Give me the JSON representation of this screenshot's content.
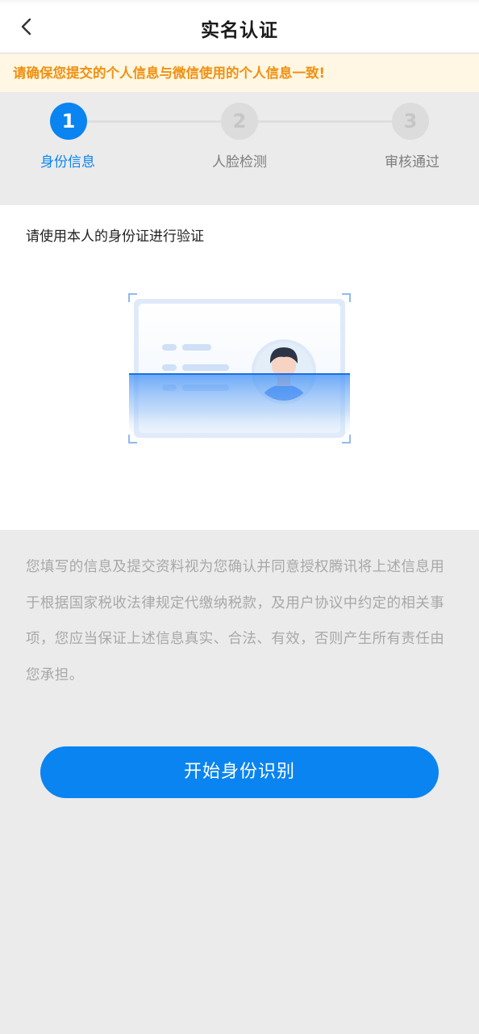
{
  "header": {
    "title": "实名认证",
    "back_icon": "chevron-left-icon"
  },
  "notice": {
    "text": "请确保您提交的个人信息与微信使用的个人信息一致!",
    "color": "#f09012"
  },
  "steps": [
    {
      "number": "1",
      "label": "身份信息",
      "state": "active"
    },
    {
      "number": "2",
      "label": "人脸检测",
      "state": "pending"
    },
    {
      "number": "3",
      "label": "审核通过",
      "state": "pending"
    }
  ],
  "card": {
    "instruction": "请使用本人的身份证进行验证",
    "illustration_icon": "id-card-scan-icon"
  },
  "disclaimer": {
    "text": "您填写的信息及提交资料视为您确认并同意授权腾讯将上述信息用于根据国家税收法律规定代缴纳税款，及用户协议中约定的相关事项，您应当保证上述信息真实、合法、有效，否则产生所有责任由您承担。"
  },
  "actions": {
    "start_label": "开始身份识别"
  },
  "colors": {
    "accent": "#0a84f0",
    "background": "#ebebeb"
  }
}
